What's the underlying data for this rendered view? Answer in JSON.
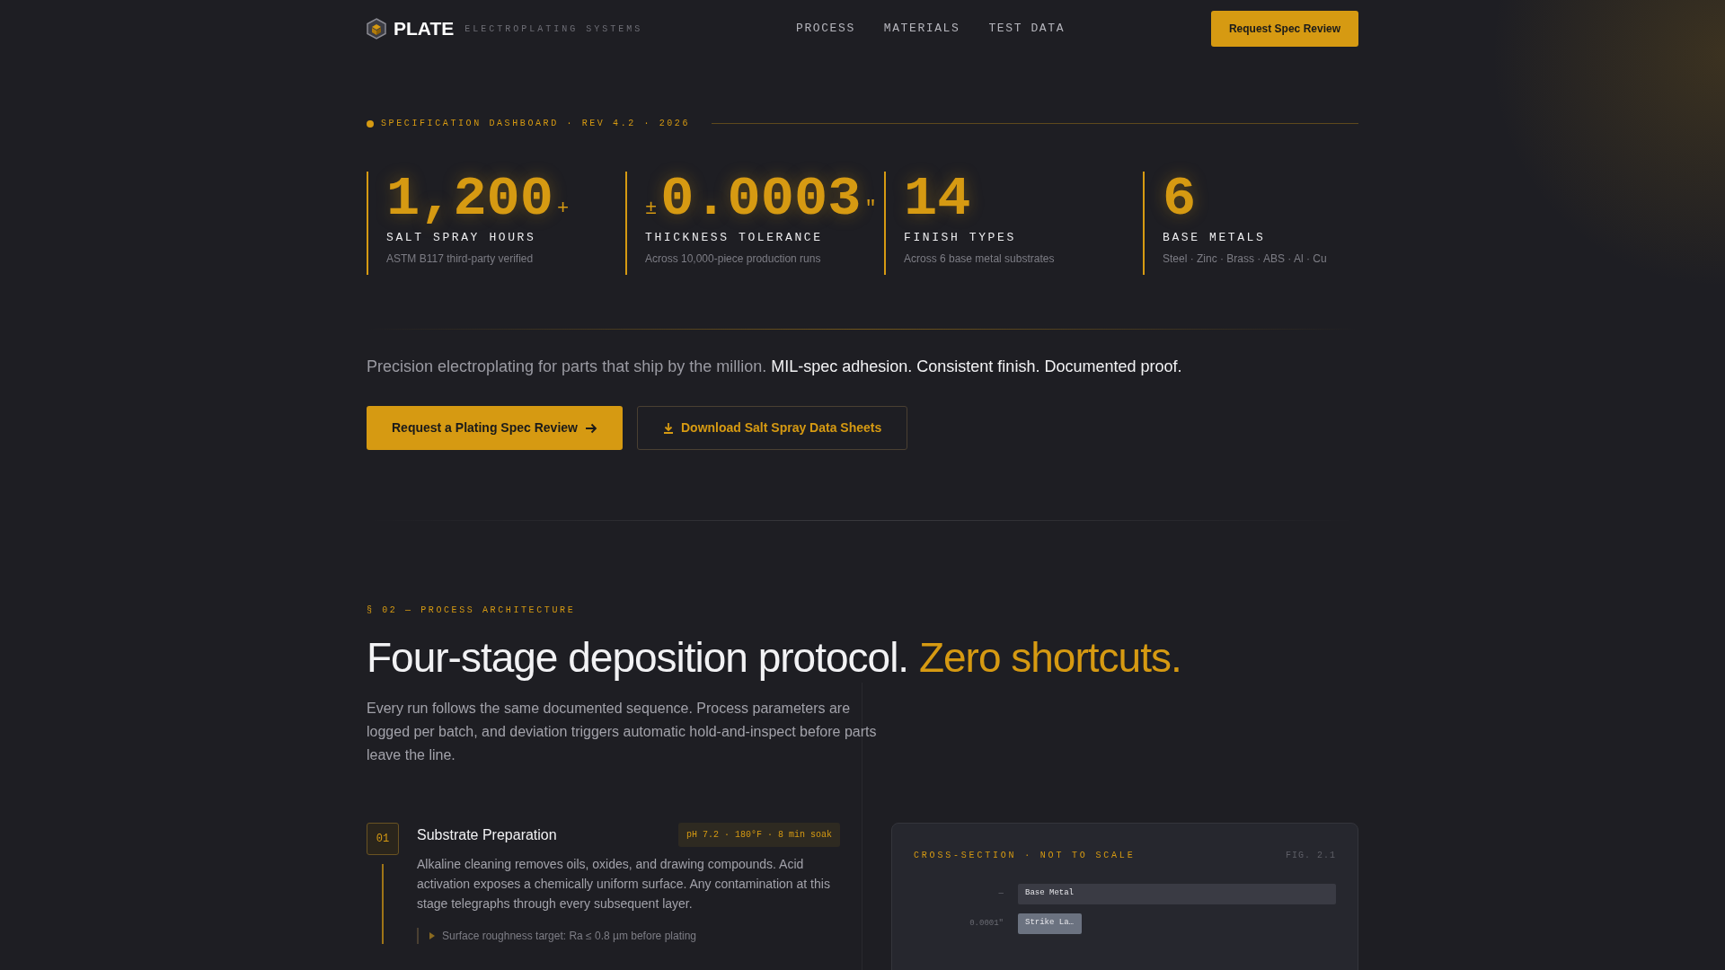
{
  "nav": {
    "brand": "PLATE",
    "tagline": "ELECTROPLATING SYSTEMS",
    "links": [
      "PROCESS",
      "MATERIALS",
      "TEST DATA"
    ],
    "cta": "Request Spec Review"
  },
  "hero": {
    "eyebrow": "SPECIFICATION DASHBOARD · REV 4.2 · 2026",
    "stats": [
      {
        "value": "1,200",
        "suffix": "+",
        "label": "SALT SPRAY HOURS",
        "note": "ASTM B117 third-party verified"
      },
      {
        "prefix": "±",
        "value": "0.0003",
        "suffix": "\"",
        "label": "THICKNESS TOLERANCE",
        "note": "Across 10,000-piece production runs"
      },
      {
        "value": "14",
        "label": "FINISH TYPES",
        "note": "Across 6 base metal substrates"
      },
      {
        "value": "6",
        "label": "BASE METALS",
        "note": "Steel · Zinc · Brass · ABS · Al · Cu"
      }
    ],
    "lead": "Precision electroplating for parts that ship by the million.",
    "lead_emphasis": "MIL-spec adhesion. Consistent finish. Documented proof.",
    "buttons": [
      {
        "kind": "primary",
        "label": "Request a Plating Spec Review"
      },
      {
        "kind": "outline",
        "label": "Download Salt Spray Data Sheets"
      }
    ]
  },
  "process": {
    "eyebrow": "§ 02 — PROCESS ARCHITECTURE",
    "title": "Four-stage deposition protocol.",
    "title_accent": "Zero shortcuts.",
    "intro": "Every run follows the same documented sequence. Process parameters are logged per batch, and deviation triggers automatic hold-and-inspect before parts leave the line.",
    "steps": [
      {
        "number": "01",
        "title": "Substrate Preparation",
        "params": "pH 7.2 · 180°F · 8 min soak",
        "body": "Alkaline cleaning removes oils, oxides, and drawing compounds. Acid activation exposes a chemically uniform surface. Any contamination at this stage telegraphs through every subsequent layer.",
        "note": "Surface roughness target: Ra ≤ 0.8 µm before plating"
      }
    ],
    "figure": {
      "title": "CROSS-SECTION · NOT TO SCALE",
      "fig": "FIG. 2.1",
      "layers": [
        {
          "thickness": "—",
          "name": "Base Metal",
          "color": "#3a3b44"
        },
        {
          "thickness": "0.0001\"",
          "name": "Strike La…",
          "color": "#6b7280"
        }
      ]
    }
  }
}
